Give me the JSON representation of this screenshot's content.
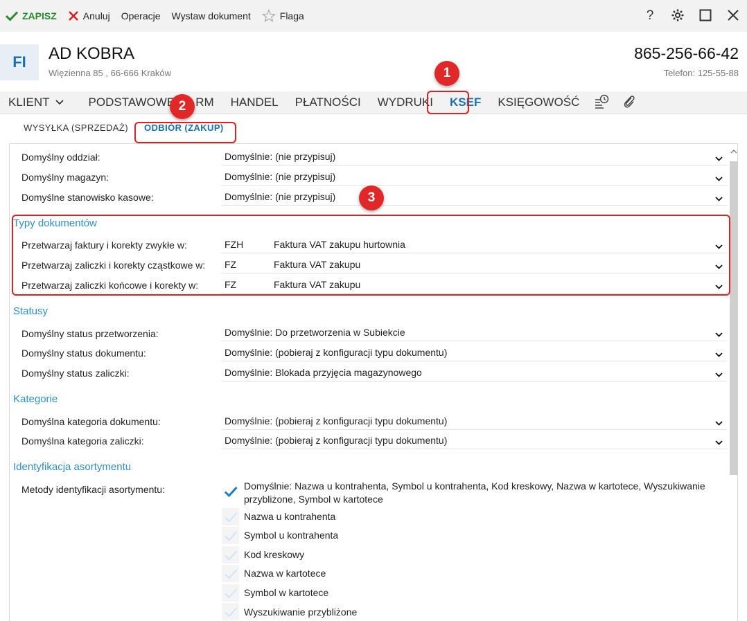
{
  "toolbar": {
    "save_label": "ZAPISZ",
    "cancel_label": "Anuluj",
    "operations_label": "Operacje",
    "issue_doc_label": "Wystaw dokument",
    "flag_label": "Flaga",
    "help_label": "?"
  },
  "header": {
    "avatar_text": "FI",
    "company_name": "AD KOBRA",
    "address": "Więzienna  85 , 66-666 Kraków",
    "phone_main": "865-256-66-42",
    "phone_sub": "Telefon: 125-55-88"
  },
  "main_tabs": {
    "klient": "KLIENT",
    "podstawowe": "PODSTAWOWE",
    "firm": "RM",
    "handel": "HANDEL",
    "platnosci": "PŁATNOŚCI",
    "wydruki": "WYDRUKI",
    "ksef": "KSEF",
    "ksiegowosc": "KSIĘGOWOŚĆ"
  },
  "sub_tabs": {
    "wysylka": "WYSYŁKA (SPRZEDAŻ)",
    "odbior": "ODBIÓR (ZAKUP)"
  },
  "general": {
    "oddzial_label": "Domyślny oddział:",
    "oddzial_value": "Domyślnie: (nie przypisuj)",
    "magazyn_label": "Domyślny magazyn:",
    "magazyn_value": "Domyślnie: (nie przypisuj)",
    "stanowisko_label": "Domyślne stanowisko kasowe:",
    "stanowisko_value": "Domyślnie: (nie przypisuj)"
  },
  "typy": {
    "title": "Typy dokumentów",
    "rows": [
      {
        "label": "Przetwarzaj faktury i korekty zwykłe w:",
        "code": "FZH",
        "name": "Faktura VAT zakupu hurtownia"
      },
      {
        "label": "Przetwarzaj zaliczki i korekty cząstkowe w:",
        "code": "FZ",
        "name": "Faktura VAT zakupu"
      },
      {
        "label": "Przetwarzaj zaliczki końcowe i korekty w:",
        "code": "FZ",
        "name": "Faktura VAT zakupu"
      }
    ]
  },
  "statusy": {
    "title": "Statusy",
    "przetworzenia_label": "Domyślny status przetworzenia:",
    "przetworzenia_value": "Domyślnie: Do przetworzenia w Subiekcie",
    "dokumentu_label": "Domyślny status dokumentu:",
    "dokumentu_value": "Domyślnie: (pobieraj z konfiguracji typu dokumentu)",
    "zaliczki_label": "Domyślny status zaliczki:",
    "zaliczki_value": "Domyślnie: Blokada przyjęcia magazynowego"
  },
  "kategorie": {
    "title": "Kategorie",
    "dokumentu_label": "Domyślna kategoria dokumentu:",
    "dokumentu_value": "Domyślnie: (pobieraj z konfiguracji typu dokumentu)",
    "zaliczki_label": "Domyślna kategoria zaliczki:",
    "zaliczki_value": "Domyślnie: (pobieraj z konfiguracji typu dokumentu)"
  },
  "identyfikacja": {
    "title": "Identyfikacja asortymentu",
    "metody_label": "Metody identyfikacji asortymentu:",
    "default_line1": "Domyślnie: Nazwa u kontrahenta, Symbol u kontrahenta, Kod kreskowy, Nazwa w kartotece, Wyszukiwanie",
    "default_line2": "przybliżone, Symbol w kartotece",
    "options": [
      "Nazwa u kontrahenta",
      "Symbol u kontrahenta",
      "Kod kreskowy",
      "Nazwa w kartotece",
      "Symbol w kartotece",
      "Wyszukiwanie przybliżone"
    ]
  },
  "annotations": {
    "badge1": "1",
    "badge2": "2",
    "badge3": "3"
  },
  "colors": {
    "accent": "#1a6fb0",
    "section": "#2e8fc4",
    "annotation_red": "#e02020",
    "save_green": "#2a8a2a"
  }
}
